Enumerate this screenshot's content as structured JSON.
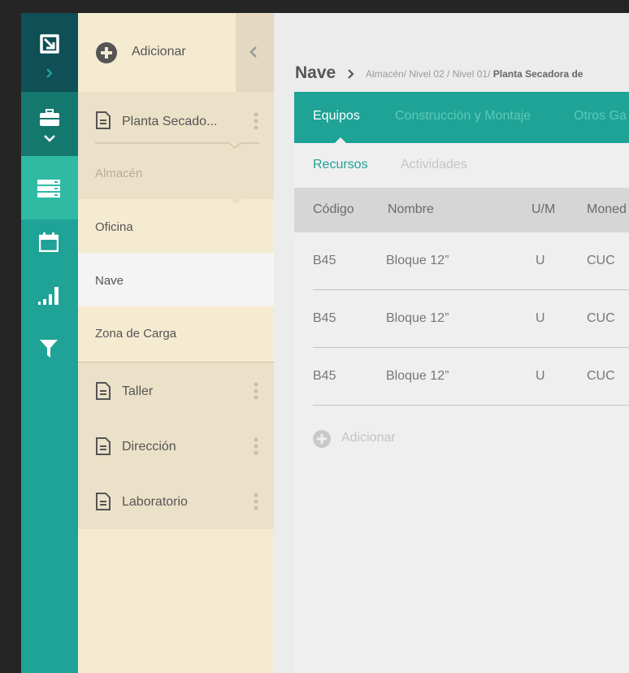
{
  "colors": {
    "teal": "#1fa396",
    "teal_dark": "#15786f",
    "teal_deepest": "#0f4f55",
    "teal_active": "#2fbaa4",
    "cream": "#f5ebd1",
    "cream_dark": "#ebe1c8",
    "page_bg": "#ececec"
  },
  "rail": {
    "icons": [
      "logo-icon",
      "chevron-right-icon",
      "briefcase-icon",
      "chevron-down-icon",
      "server-icon",
      "calendar-icon",
      "signal-bars-icon",
      "filter-icon"
    ]
  },
  "tree": {
    "add_label": "Adicionar",
    "nodes": [
      {
        "label": "Planta Secado...",
        "children": [
          "Almacén",
          "Oficina",
          "Nave",
          "Zona de Carga"
        ]
      },
      {
        "label": "Taller"
      },
      {
        "label": "Dirección"
      },
      {
        "label": "Laboratorio"
      }
    ],
    "selected_child": "Nave"
  },
  "breadcrumb": {
    "title": "Nave",
    "path": "Almacén/ Nivel 02 / Nivel 01/",
    "path_bold": "Planta Secadora de"
  },
  "tabs": [
    "Equipos",
    "Construcción y Montaje",
    "Otros Ga"
  ],
  "active_tab": "Equipos",
  "subtabs": [
    "Recursos",
    "Actividades"
  ],
  "active_subtab": "Recursos",
  "table": {
    "headers": [
      "Código",
      "Nombre",
      "U/M",
      "Moned"
    ],
    "rows": [
      [
        "B45",
        "Bloque 12”",
        "U",
        "CUC"
      ],
      [
        "B45",
        "Bloque 12”",
        "U",
        "CUC"
      ],
      [
        "B45",
        "Bloque 12”",
        "U",
        "CUC"
      ]
    ]
  },
  "add_row_label": "Adicionar"
}
